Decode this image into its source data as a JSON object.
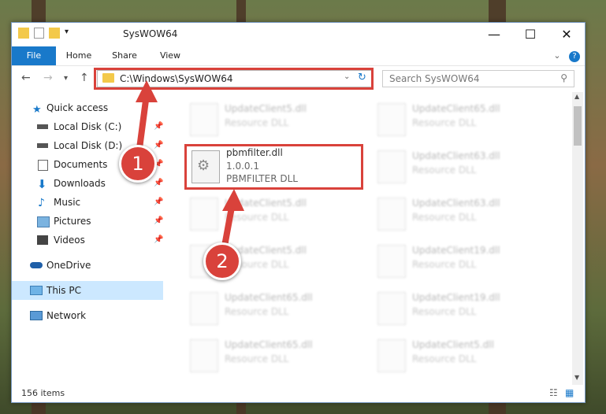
{
  "window": {
    "title": "SysWOW64",
    "minimize_glyph": "—",
    "maximize_glyph": "☐",
    "close_glyph": "✕"
  },
  "ribbon": {
    "tabs": [
      "File",
      "Home",
      "Share",
      "View"
    ]
  },
  "nav": {
    "address": "C:\\Windows\\SysWOW64",
    "search_placeholder": "Search SysWOW64"
  },
  "sidebar": {
    "items": [
      {
        "label": "Quick access",
        "icon": "star-icon"
      },
      {
        "label": "Local Disk (C:)",
        "icon": "drive-icon"
      },
      {
        "label": "Local Disk (D:)",
        "icon": "drive-icon"
      },
      {
        "label": "Documents",
        "icon": "documents-icon"
      },
      {
        "label": "Downloads",
        "icon": "downloads-icon"
      },
      {
        "label": "Music",
        "icon": "music-icon"
      },
      {
        "label": "Pictures",
        "icon": "pictures-icon"
      },
      {
        "label": "Videos",
        "icon": "videos-icon"
      },
      {
        "label": "OneDrive",
        "icon": "cloud-icon"
      },
      {
        "label": "This PC",
        "icon": "computer-icon"
      },
      {
        "label": "Network",
        "icon": "network-icon"
      }
    ]
  },
  "files": {
    "left": [
      {
        "name": "UpdateClient5.dll",
        "type": "Resource DLL"
      },
      {
        "name": "pbmfilter.dll",
        "type": "1.0.0.1",
        "desc": "PBMFILTER DLL"
      },
      {
        "name": "UpdateClient5.dll",
        "type": "Resource DLL"
      },
      {
        "name": "UpdateClient5.dll",
        "type": "Resource DLL"
      },
      {
        "name": "UpdateClient65.dll",
        "type": "Resource DLL"
      },
      {
        "name": "UpdateClient65.dll",
        "type": "Resource DLL"
      }
    ],
    "right": [
      {
        "name": "UpdateClient65.dll",
        "type": "Resource DLL"
      },
      {
        "name": "UpdateClient63.dll",
        "type": "Resource DLL"
      },
      {
        "name": "UpdateClient63.dll",
        "type": "Resource DLL"
      },
      {
        "name": "UpdateClient19.dll",
        "type": "Resource DLL"
      },
      {
        "name": "UpdateClient19.dll",
        "type": "Resource DLL"
      },
      {
        "name": "UpdateClient5.dll",
        "type": "Resource DLL"
      }
    ]
  },
  "status": {
    "count": "156 items"
  },
  "callouts": [
    "1",
    "2"
  ],
  "colors": {
    "accent": "#1979ca",
    "highlight": "#d9423b",
    "selected": "#cce8ff"
  }
}
